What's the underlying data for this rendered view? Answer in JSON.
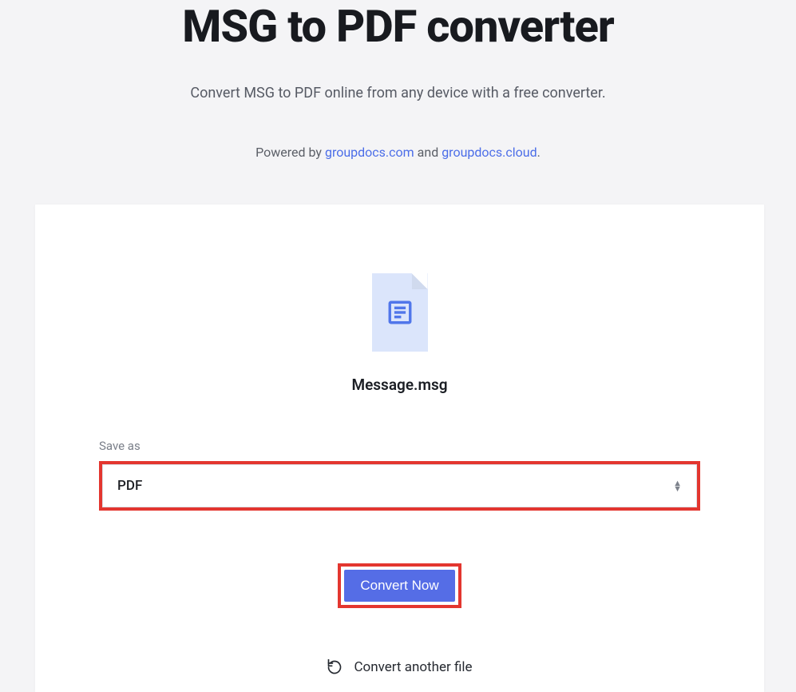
{
  "header": {
    "title": "MSG to PDF converter",
    "subtitle": "Convert MSG to PDF online from any device with a free converter.",
    "powered_prefix": "Powered by ",
    "link1_text": "groupdocs.com",
    "and_text": " and ",
    "link2_text": "groupdocs.cloud",
    "powered_suffix": "."
  },
  "file": {
    "name": "Message.msg",
    "icon": "document-icon"
  },
  "saveas": {
    "label": "Save as",
    "selected": "PDF"
  },
  "actions": {
    "convert_label": "Convert Now",
    "another_label": "Convert another file"
  }
}
